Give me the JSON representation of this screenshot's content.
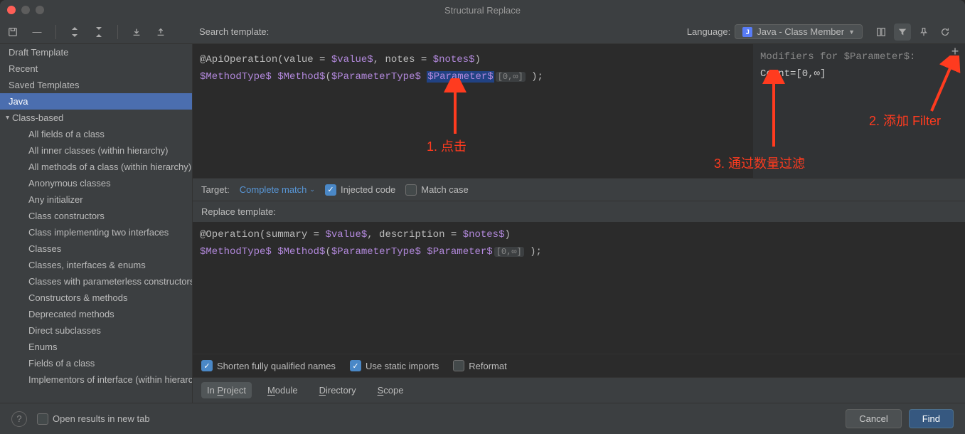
{
  "title": "Structural Replace",
  "search_label": "Search template:",
  "language_label": "Language:",
  "language_value": "Java - Class Member",
  "sidebar": {
    "draft": "Draft Template",
    "recent": "Recent",
    "saved": "Saved Templates",
    "java": "Java",
    "group": "Class-based",
    "items": [
      "All fields of a class",
      "All inner classes (within hierarchy)",
      "All methods of a class (within hierarchy)",
      "Anonymous classes",
      "Any initializer",
      "Class constructors",
      "Class implementing two interfaces",
      "Classes",
      "Classes, interfaces & enums",
      "Classes with parameterless constructors",
      "Constructors & methods",
      "Deprecated methods",
      "Direct subclasses",
      "Enums",
      "Fields of a class",
      "Implementors of interface (within hierarchy)"
    ]
  },
  "search_code": {
    "l1a": "@ApiOperation(value = ",
    "l1b": "$value$",
    "l1c": ", notes = ",
    "l1d": "$notes$",
    "l1e": ")",
    "l2a": "$MethodType$",
    "l2b": " ",
    "l2c": "$Method$",
    "l2d": "(",
    "l2e": "$ParameterType$",
    "l2f": " ",
    "l2g": "$Parameter$",
    "l2h": "[0,∞]",
    "l2i": " );"
  },
  "modifiers": {
    "title": "Modifiers for $Parameter$:",
    "count": "Count=[0,∞]"
  },
  "target": {
    "label": "Target:",
    "value": "Complete match",
    "injected": "Injected code",
    "matchcase": "Match case"
  },
  "replace_label": "Replace template:",
  "replace_code": {
    "l1a": "@Operation(summary = ",
    "l1b": "$value$",
    "l1c": ", description = ",
    "l1d": "$notes$",
    "l1e": ")",
    "l2a": "$MethodType$",
    "l2b": " ",
    "l2c": "$Method$",
    "l2d": "(",
    "l2e": "$ParameterType$",
    "l2f": " ",
    "l2g": "$Parameter$",
    "l2h": "[0,∞]",
    "l2i": " );"
  },
  "options": {
    "shorten": "Shorten fully qualified names",
    "static": "Use static imports",
    "reformat": "Reformat"
  },
  "scope": {
    "tabs": [
      "In Project",
      "Module",
      "Directory",
      "Scope"
    ]
  },
  "footer": {
    "open_new": "Open results in new tab",
    "cancel": "Cancel",
    "find": "Find"
  },
  "annotations": {
    "a1": "1. 点击",
    "a2": "2. 添加 Filter",
    "a3": "3. 通过数量过滤"
  }
}
